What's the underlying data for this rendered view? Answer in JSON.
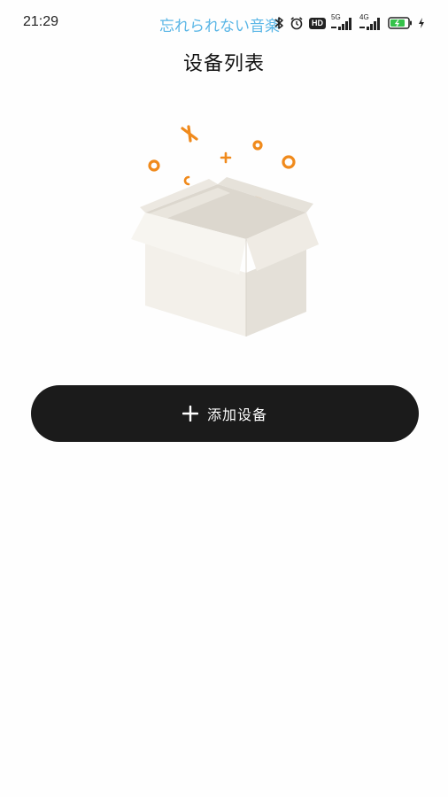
{
  "status_bar": {
    "time": "21:29",
    "now_playing": "忘れられない音楽",
    "icons": [
      "bluetooth-icon",
      "alarm-icon",
      "hd-icon",
      "signal-5g-icon",
      "signal-4g-icon",
      "battery-icon",
      "charging-icon"
    ],
    "hd_label": "HD",
    "network_1": "5G",
    "network_2": "4G"
  },
  "header": {
    "title": "设备列表"
  },
  "empty_state": {
    "illustration": "empty-box-icon",
    "accent_color": "#f08a1c",
    "box_color": "#efebe4"
  },
  "actions": {
    "add_device_label": "添加设备",
    "add_device_icon": "plus-icon",
    "button_color": "#1b1b1b"
  }
}
